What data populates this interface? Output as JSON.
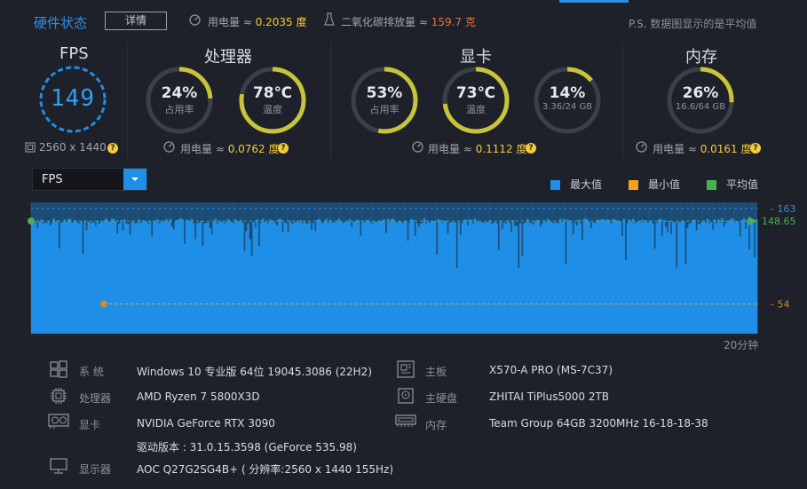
{
  "header": {
    "title": "硬件状态",
    "detail_button": "详情",
    "power_label": "用电量 ≈ ",
    "power_value": "0.2035 度",
    "co2_label": "二氧化碳排放量 ≈ ",
    "co2_value": "159.7 克",
    "note": "P.S. 数据图显示的是平均值"
  },
  "fps_panel": {
    "title": "FPS",
    "value": "149",
    "resolution": "2560 x 1440"
  },
  "cpu_panel": {
    "title": "处理器",
    "usage_value": "24%",
    "usage_label": "占用率",
    "usage_fraction": 0.24,
    "temp_value": "78℃",
    "temp_label": "温度",
    "temp_fraction": 0.78,
    "power_label": "用电量 ≈ ",
    "power_value": "0.0762 度"
  },
  "gpu_panel": {
    "title": "显卡",
    "usage_value": "53%",
    "usage_label": "占用率",
    "usage_fraction": 0.53,
    "temp_value": "73℃",
    "temp_label": "温度",
    "temp_fraction": 0.73,
    "vram_value": "14%",
    "vram_detail": "3.36/24 GB",
    "vram_fraction": 0.14,
    "power_label": "用电量 ≈ ",
    "power_value": "0.1112 度"
  },
  "mem_panel": {
    "title": "内存",
    "usage_value": "26%",
    "usage_detail": "16.6/64 GB",
    "usage_fraction": 0.26,
    "power_label": "用电量 ≈ ",
    "power_value": "0.0161 度"
  },
  "chart_selector": {
    "selected": "FPS"
  },
  "legend": {
    "max": "最大值",
    "min": "最小值",
    "avg": "平均值"
  },
  "colors": {
    "accent": "#1e8ee6",
    "max": "#1e8ee6",
    "min": "#f2a31c",
    "avg": "#4caf50",
    "ring_yellow": "#c8c43a",
    "ring_green": "#3fa35a"
  },
  "chart_data": {
    "type": "area",
    "series": [
      {
        "values": []
      }
    ],
    "max": 163,
    "min": 54,
    "avg": 148.65,
    "max_label": "163",
    "min_label": "54",
    "avg_label": "148.65",
    "xlabel": "20分钟"
  },
  "system": {
    "os_label": "系  统",
    "os_value": "Windows 10 专业版 64位 19045.3086 (22H2)",
    "cpu_label": "处理器",
    "cpu_value": "AMD Ryzen 7 5800X3D",
    "gpu_label": "显卡",
    "gpu_value": "NVIDIA GeForce RTX 3090",
    "driver_value": "驱动版本 : 31.0.15.3598 (GeForce 535.98)",
    "display_label": "显示器",
    "display_value": "AOC Q27G2SG4B+ ( 分辨率:2560 x 1440 155Hz)",
    "board_label": "主板",
    "board_value": "X570-A PRO (MS-7C37)",
    "disk_label": "主硬盘",
    "disk_value": "ZHITAI TiPlus5000 2TB",
    "ram_label": "内存",
    "ram_value": "Team Group 64GB 3200MHz 16-18-18-38"
  }
}
